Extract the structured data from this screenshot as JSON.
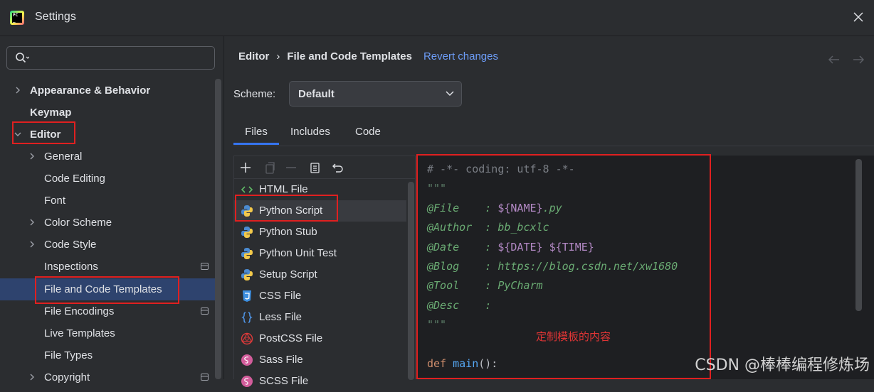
{
  "window": {
    "title": "Settings"
  },
  "search": {
    "placeholder": "",
    "value": ""
  },
  "sidebar": {
    "items": [
      {
        "label": "Appearance & Behavior",
        "expandable": true,
        "expanded": false,
        "bold": true
      },
      {
        "label": "Keymap",
        "expandable": false,
        "bold": true
      },
      {
        "label": "Editor",
        "expandable": true,
        "expanded": true,
        "bold": true
      },
      {
        "label": "General",
        "expandable": true
      },
      {
        "label": "Code Editing"
      },
      {
        "label": "Font"
      },
      {
        "label": "Color Scheme",
        "expandable": true
      },
      {
        "label": "Code Style",
        "expandable": true
      },
      {
        "label": "Inspections",
        "project_icon": true
      },
      {
        "label": "File and Code Templates",
        "selected": true
      },
      {
        "label": "File Encodings",
        "project_icon": true
      },
      {
        "label": "Live Templates"
      },
      {
        "label": "File Types"
      },
      {
        "label": "Copyright",
        "expandable": true,
        "project_icon": true
      }
    ]
  },
  "breadcrumb": {
    "root": "Editor",
    "separator": "›",
    "current": "File and Code Templates",
    "revert": "Revert changes"
  },
  "scheme": {
    "label": "Scheme:",
    "value": "Default"
  },
  "tabs": [
    {
      "label": "Files",
      "active": true
    },
    {
      "label": "Includes"
    },
    {
      "label": "Code"
    }
  ],
  "toolbar": {
    "buttons": [
      "add-icon",
      "copy-template-icon",
      "remove-icon",
      "clipboard-icon",
      "reset-icon"
    ]
  },
  "files": [
    {
      "name": "HTML File",
      "icon": "html-icon"
    },
    {
      "name": "Python Script",
      "icon": "python-icon",
      "selected": true
    },
    {
      "name": "Python Stub",
      "icon": "python-icon"
    },
    {
      "name": "Python Unit Test",
      "icon": "python-icon"
    },
    {
      "name": "Setup Script",
      "icon": "python-icon"
    },
    {
      "name": "CSS File",
      "icon": "css-icon"
    },
    {
      "name": "Less File",
      "icon": "less-icon"
    },
    {
      "name": "PostCSS File",
      "icon": "postcss-icon"
    },
    {
      "name": "Sass File",
      "icon": "sass-icon"
    },
    {
      "name": "SCSS File",
      "icon": "sass-icon"
    }
  ],
  "code": {
    "l1": "# -*- coding: utf-8 -*-",
    "l2": "\"\"\"",
    "file_key": "@File    : ",
    "file_var": "${NAME}",
    "file_ext": ".py",
    "author_line": "@Author  : bb_bcxlc",
    "date_key": "@Date    : ",
    "date_var1": "${DATE}",
    "date_sp": " ",
    "date_var2": "${TIME}",
    "blog_line": "@Blog    : https://blog.csdn.net/xw1680",
    "tool_line": "@Tool    : PyCharm",
    "desc_line": "@Desc    :",
    "l9": "\"\"\"",
    "def_kw": "def ",
    "def_fn": "main",
    "def_rest": "():"
  },
  "annotation": "定制模板的内容",
  "watermark": "CSDN @棒棒编程修炼场",
  "colors": {
    "accent": "#3574f0",
    "link": "#6d9df8",
    "highlight": "#e02020",
    "selection": "#2e436e"
  }
}
